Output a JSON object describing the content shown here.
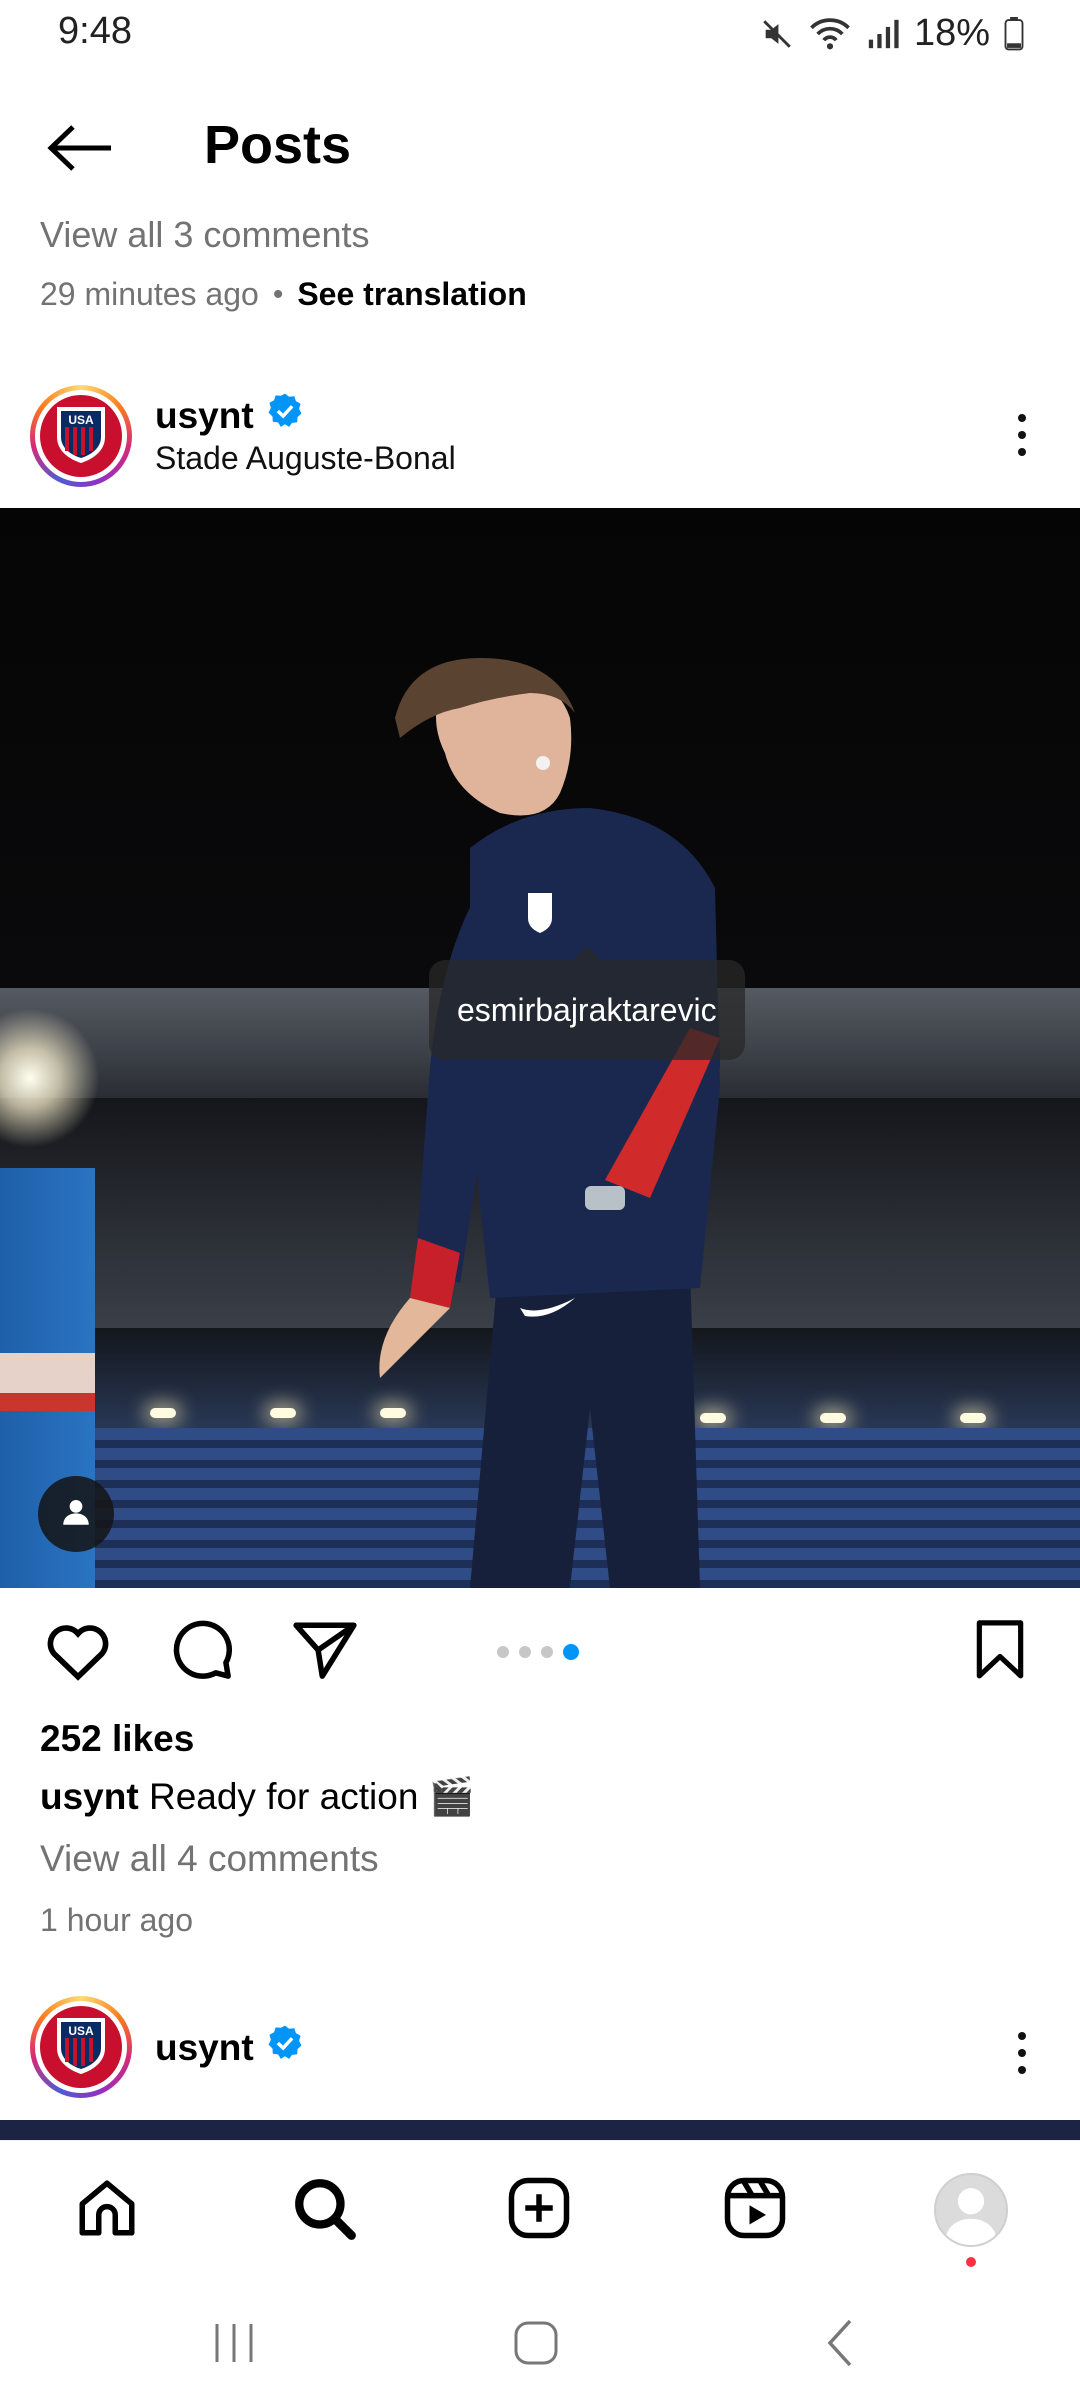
{
  "status_bar": {
    "time": "9:48",
    "battery": "18%",
    "icons": [
      "mute-icon",
      "wifi-icon",
      "signal-icon",
      "battery-icon"
    ]
  },
  "header": {
    "title": "Posts",
    "back_icon": "arrow-left-icon"
  },
  "previous_post": {
    "view_comments": "View all 3 comments",
    "time_ago": "29 minutes ago",
    "separator": "•",
    "see_translation": "See translation"
  },
  "post": {
    "username": "usynt",
    "verified": true,
    "location": "Stade Auguste-Bonal",
    "tag": "esmirbajraktarevic",
    "carousel": {
      "count": 4,
      "active_index": 4
    },
    "likes": "252 likes",
    "caption_user": "usynt",
    "caption_text": " Ready for action 🎬",
    "view_comments": "View all 4 comments",
    "time_ago": "1 hour ago"
  },
  "next_post": {
    "username": "usynt",
    "verified": true
  },
  "bottom_nav": {
    "items": [
      "home-icon",
      "search-icon",
      "create-icon",
      "reels-icon",
      "profile-avatar"
    ]
  },
  "system_nav": {
    "items": [
      "recents-icon",
      "home-icon",
      "back-icon"
    ]
  },
  "colors": {
    "accent_blue": "#0095f6",
    "usa_red": "#c8102e",
    "secondary_text": "#737373"
  }
}
